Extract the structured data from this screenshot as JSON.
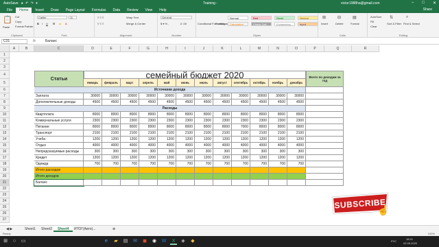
{
  "titlebar": {
    "autosave": "AutoSave",
    "title": "Training -",
    "account": "victor1988ha@gmail.com"
  },
  "ribbon_tabs": [
    "File",
    "Home",
    "Insert",
    "Draw",
    "Page Layout",
    "Formulas",
    "Data",
    "Review",
    "View",
    "Help"
  ],
  "share": "Share",
  "ribbon": {
    "clipboard": {
      "label": "Clipboard",
      "cut": "Cut",
      "copy": "Copy",
      "format_painter": "Format Painter",
      "paste": "Paste"
    },
    "font": {
      "label": "Font",
      "name": "Calibri",
      "size": "11"
    },
    "alignment": {
      "label": "Alignment",
      "wrap": "Wrap Text",
      "merge": "Merge & Center"
    },
    "number": {
      "label": "Number",
      "format": "General"
    },
    "styles": {
      "label": "Styles",
      "cond": "Conditional Formatting",
      "table": "Format as Table",
      "normal": "Normal",
      "bad": "Bad",
      "good": "Good",
      "neutral": "Neutral",
      "calculation": "Calculation",
      "check_cell": "Check Cell",
      "explanatory": "Explanatory...",
      "input": "Input"
    },
    "cells": {
      "label": "Cells",
      "insert": "Insert",
      "delete": "Delete",
      "format": "Format"
    },
    "editing": {
      "label": "Editing",
      "autosum": "AutoSum",
      "fill": "Fill",
      "clear": "Clear",
      "sort": "Sort & Filter",
      "find": "Find & Select"
    }
  },
  "formula_bar": {
    "name_box": "C21",
    "fx": "fx",
    "formula": "Баланс"
  },
  "columns": [
    "A",
    "B",
    "C",
    "D",
    "E",
    "F",
    "G",
    "H",
    "I",
    "J",
    "K",
    "L",
    "M",
    "N",
    "O",
    "P",
    "Q",
    "R"
  ],
  "rows": [
    "1",
    "2",
    "3",
    "4",
    "5",
    "6",
    "7",
    "8",
    "9",
    "10",
    "11",
    "12",
    "13",
    "14",
    "15",
    "16",
    "17",
    "18",
    "19",
    "20",
    "21",
    "22",
    "23",
    "24",
    "25",
    "26",
    "27"
  ],
  "sheet": {
    "title": "семейный бюджет 2020",
    "statii": "Статьи",
    "year_total": "Всего по доходам за год",
    "months": [
      "январь",
      "февраль",
      "март",
      "апрель",
      "май",
      "июнь",
      "июль",
      "август",
      "сентябрь",
      "октябрь",
      "ноябрь",
      "декабрь"
    ],
    "income_section": "Источники дохода",
    "income": [
      {
        "label": "Заплата",
        "values": [
          "30000",
          "30000",
          "30000",
          "30000",
          "30000",
          "30000",
          "30000",
          "30000",
          "30000",
          "30000",
          "30000",
          "30000"
        ]
      },
      {
        "label": "Дополнительные доходы",
        "values": [
          "4500",
          "4500",
          "4500",
          "4500",
          "4500",
          "4500",
          "4500",
          "4500",
          "4500",
          "4500",
          "4500",
          "4500"
        ]
      }
    ],
    "expense_section": "Расходы",
    "expenses": [
      {
        "label": "Квартплата",
        "values": [
          "8000",
          "8000",
          "8000",
          "8000",
          "8000",
          "8000",
          "8000",
          "8000",
          "8000",
          "8000",
          "8000",
          "8000"
        ]
      },
      {
        "label": "Коммунальные услуги",
        "values": [
          "2300",
          "2300",
          "2300",
          "2300",
          "2300",
          "2300",
          "2300",
          "2300",
          "2300",
          "2300",
          "2300",
          "2300"
        ]
      },
      {
        "label": "Питание",
        "values": [
          "8000",
          "8000",
          "8000",
          "8000",
          "8000",
          "8000",
          "8000",
          "8000",
          "7000",
          "8000",
          "8000",
          "8000"
        ]
      },
      {
        "label": "Транспорт",
        "values": [
          "2100",
          "2100",
          "2100",
          "2100",
          "2100",
          "2100",
          "2100",
          "2100",
          "2100",
          "2100",
          "2100",
          "2100"
        ]
      },
      {
        "label": "Учеба",
        "values": [
          "1200",
          "1200",
          "1200",
          "1200",
          "1200",
          "1200",
          "1200",
          "1200",
          "1200",
          "1200",
          "1200",
          "1200"
        ]
      },
      {
        "label": "Отдых",
        "values": [
          "4000",
          "4000",
          "4000",
          "4000",
          "4000",
          "4000",
          "4000",
          "4000",
          "4000",
          "4000",
          "4000",
          "4000"
        ]
      },
      {
        "label": "Непредсказуемые расходы",
        "values": [
          "300",
          "300",
          "300",
          "300",
          "300",
          "300",
          "300",
          "300",
          "300",
          "300",
          "300",
          "300"
        ]
      },
      {
        "label": "Кредит",
        "values": [
          "1200",
          "1200",
          "1200",
          "1200",
          "1200",
          "1200",
          "1200",
          "1200",
          "1200",
          "1200",
          "1200",
          "1200"
        ]
      },
      {
        "label": "Одежда",
        "values": [
          "700",
          "700",
          "700",
          "700",
          "700",
          "700",
          "700",
          "700",
          "700",
          "700",
          "700",
          "700"
        ]
      }
    ],
    "total_expenses": "Итого расходов",
    "total_income": "Итого доходов",
    "balance": "Баланс"
  },
  "sheet_tabs": [
    "Sheet1",
    "Sheet2",
    "Sheet4",
    "ИТОГ(Авто)..."
  ],
  "active_sheet": "Sheet4",
  "status": {
    "ready": "Ready",
    "zoom": "100%"
  },
  "taskbar": {
    "time": "18:21",
    "date": "02.05.2020",
    "lang": "РУС"
  },
  "subscribe": "SUBSCRIBE",
  "colors": {
    "excel_green": "#217346",
    "header_green": "#c6e0b4",
    "orange": "#ffc000",
    "lime": "#92d050",
    "month_yellow": "#fff2cc",
    "section_blue": "#dbe4f0",
    "subscribe_red": "#cc1e1e"
  }
}
